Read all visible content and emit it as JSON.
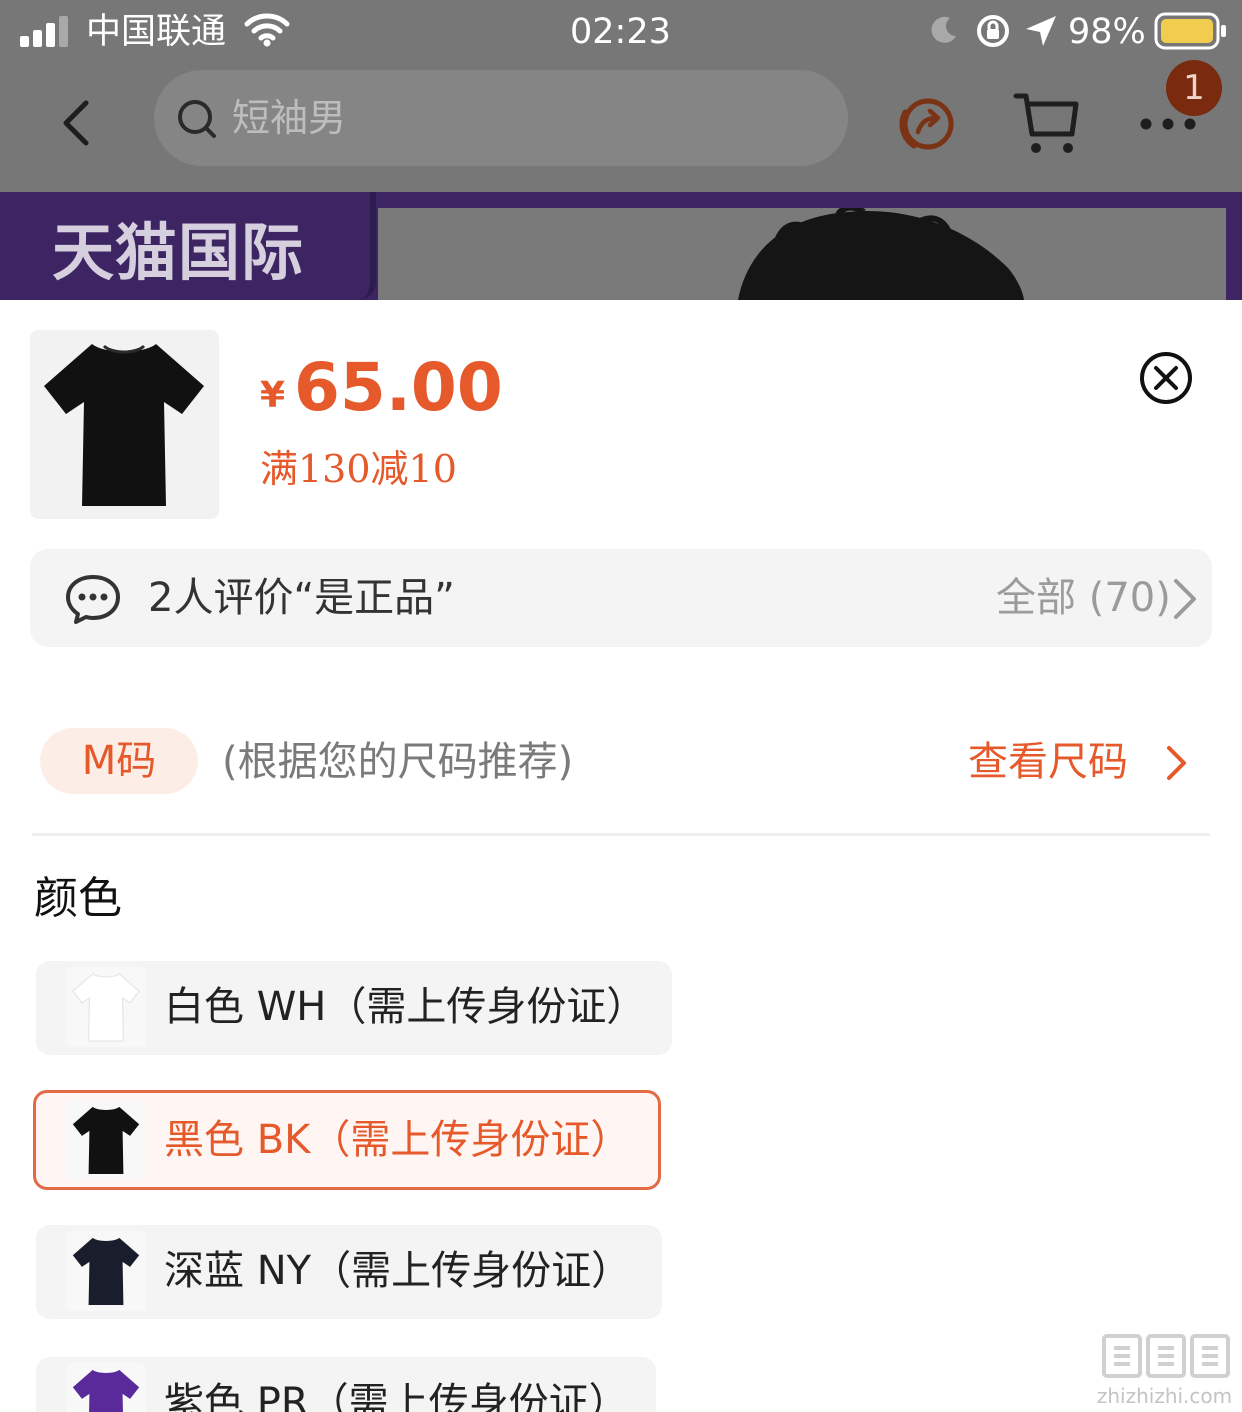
{
  "status_bar": {
    "carrier": "中国联通",
    "time": "02:23",
    "battery": "98%"
  },
  "nav": {
    "search_placeholder": "短袖男",
    "badge_count": "1"
  },
  "banner": {
    "title": "天猫国际"
  },
  "product": {
    "currency_symbol": "¥",
    "price": "65.00",
    "promo": "满130减10"
  },
  "review": {
    "summary": "2人评价“是正品”",
    "all_label": "全部 (70)"
  },
  "size": {
    "chip": "M码",
    "note": "(根据您的尺码推荐)",
    "link": "查看尺码"
  },
  "color_section": {
    "heading": "颜色",
    "options": [
      {
        "label": "白色 WH（需上传身份证）",
        "selected": false,
        "shirt_color": "#ffffff"
      },
      {
        "label": "黑色 BK（需上传身份证）",
        "selected": true,
        "shirt_color": "#111111"
      },
      {
        "label": "深蓝 NY（需上传身份证）",
        "selected": false,
        "shirt_color": "#1a1d2c"
      },
      {
        "label": "紫色 PR（需上传身份证）",
        "selected": false,
        "shirt_color": "#5b2a9a"
      }
    ]
  },
  "watermark": {
    "text": "zhizhizhi.com"
  },
  "colors": {
    "accent": "#e5592b",
    "overlay": "#777777",
    "banner": "#3d2563"
  }
}
